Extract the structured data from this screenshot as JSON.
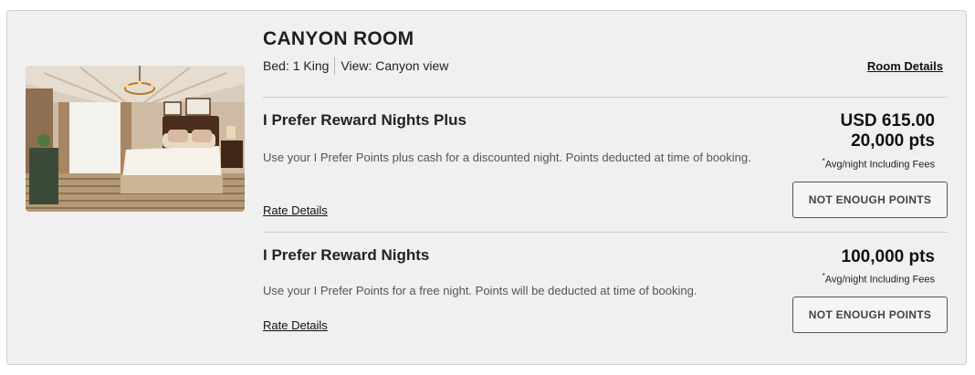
{
  "room": {
    "title": "CANYON ROOM",
    "bed": "Bed: 1 King",
    "view": "View: Canyon view",
    "details_link": "Room Details",
    "photo": "bedroom-photo"
  },
  "rates": [
    {
      "name": "I Prefer Reward Nights Plus",
      "description": "Use your I Prefer Points plus cash for a discounted night. Points deducted at time of booking.",
      "details_link": "Rate Details",
      "price_cash": "USD 615.00",
      "price_points": "20,000 pts",
      "fee_mark": "*",
      "fee_note": "Avg/night Including Fees",
      "button_label": "NOT ENOUGH POINTS"
    },
    {
      "name": "I Prefer Reward Nights",
      "description": "Use your I Prefer Points for a free night. Points will be deducted at time of booking.",
      "details_link": "Rate Details",
      "price_points": "100,000 pts",
      "fee_mark": "*",
      "fee_note": "Avg/night Including Fees",
      "button_label": "NOT ENOUGH POINTS"
    }
  ]
}
